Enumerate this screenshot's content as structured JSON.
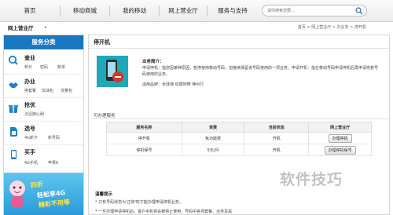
{
  "topnav": {
    "items": [
      "首页",
      "移动商城",
      "我的移动",
      "网上营业厅",
      "服务与支持"
    ],
    "search": {
      "placeholder": "请你搜索您要..."
    }
  },
  "breadcrumb": {
    "left": "网上营业厅",
    "right": "首页 > 网上营业厅 > 办业务 > 停开机"
  },
  "sidebar": {
    "title": "服务分类",
    "items": [
      {
        "name": "查业",
        "icon": "search-icon",
        "subs": [
          "积分",
          "密码",
          "账单"
        ]
      },
      {
        "name": "办业",
        "icon": "handshake-icon",
        "subs": [
          "换套餐",
          "加油包",
          "流量包"
        ]
      },
      {
        "name": "抢优",
        "icon": "gift-icon",
        "subs": [
          "沉迅随心刷"
        ]
      },
      {
        "name": "选号",
        "icon": "sim-icon",
        "subs": [
          "4G新卡",
          "新号码"
        ]
      },
      {
        "name": "买手",
        "icon": "phone-icon",
        "subs": [
          "4G手机",
          "苹果6"
        ]
      }
    ],
    "promo": {
      "line1": "四折",
      "line2": "轻松享4G",
      "line3": "精彩不用等"
    }
  },
  "main": {
    "title": "停开机",
    "intro_title": "业务简介：",
    "intro_desc": "申请停机：指您因某种原因，暂停使用移动号码，但继续保留该号码使用的一项业务。申请开机：指在移动号码申请停机后再申请恢复号码使用的业务。",
    "brand": "适用品牌：全球通 动感地带 神州行",
    "available_title": "可办理服务",
    "table": {
      "headers": [
        "服务名称",
        "资费",
        "当前状态",
        "网上营业厅"
      ],
      "rows": [
        {
          "name": "停开机",
          "fee": "免功能费",
          "status": "开机",
          "action": "办理停机"
        },
        {
          "name": "停机保号",
          "fee": "5元/月",
          "status": "开机",
          "action": "办理停机保号"
        }
      ]
    },
    "tips_title": "温馨提示",
    "tips": [
      "* 只有号码状态为'正常'时才能办理申请停机业务。",
      "* 一旦办理申请停机后，客户手机将会被停止使用，号码中各项套餐、业务及是"
    ]
  },
  "watermark": "软件技巧",
  "colors": {
    "accent": "#1a78c2",
    "tile": "#1ea8b8"
  }
}
